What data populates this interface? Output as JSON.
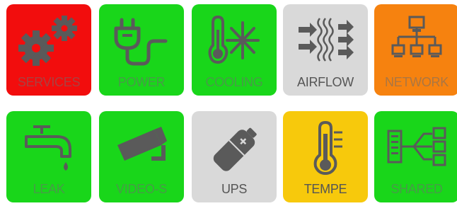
{
  "colors": {
    "red": "#f20d0d",
    "green": "#19d61a",
    "gray": "#d9d9d9",
    "orange": "#f6820f",
    "yellow": "#f7c90c",
    "icon": "#5a5a5a"
  },
  "tiles": [
    {
      "label": "SERVICES",
      "icon": "gears-icon",
      "color": "red"
    },
    {
      "label": "POWER",
      "icon": "power-plug-icon",
      "color": "green"
    },
    {
      "label": "COOLING",
      "icon": "thermometer-snowflake-icon",
      "color": "green"
    },
    {
      "label": "AIRFLOW",
      "icon": "airflow-arrows-icon",
      "color": "gray"
    },
    {
      "label": "NETWORK",
      "icon": "network-tree-icon",
      "color": "orange"
    },
    {
      "label": "LEAK",
      "icon": "faucet-drop-icon",
      "color": "green"
    },
    {
      "label": "VIDEO-S",
      "icon": "security-camera-icon",
      "color": "green"
    },
    {
      "label": "UPS",
      "icon": "battery-icon",
      "color": "gray"
    },
    {
      "label": "TEMPE",
      "icon": "thermometer-icon",
      "color": "yellow"
    },
    {
      "label": "SHARED",
      "icon": "shared-servers-icon",
      "color": "green"
    }
  ]
}
